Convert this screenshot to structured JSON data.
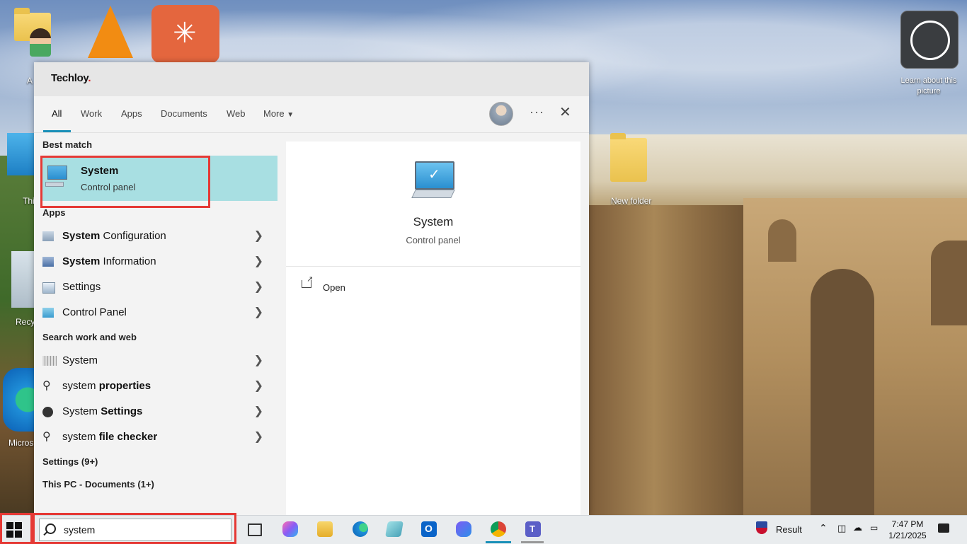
{
  "desktop": {
    "new_folder_label": "New folder",
    "learn_label": "Learn about this picture",
    "partial_labels": [
      "A",
      "Thi",
      "Recy",
      "Micros"
    ]
  },
  "panel": {
    "brand": "Techloy",
    "tabs": [
      "All",
      "Work",
      "Apps",
      "Documents",
      "Web",
      "More"
    ],
    "active_tab": "All",
    "best_match_heading": "Best match",
    "best_match": {
      "title": "System",
      "subtitle": "Control panel"
    },
    "apps_heading": "Apps",
    "apps": [
      {
        "bold": "System",
        "rest": " Configuration",
        "icon": "system-configuration-icon"
      },
      {
        "bold": "System",
        "rest": " Information",
        "icon": "system-information-icon"
      },
      {
        "bold": "",
        "rest": "Settings",
        "icon": "settings-app-icon"
      },
      {
        "bold": "",
        "rest": "Control Panel",
        "icon": "control-panel-icon"
      }
    ],
    "web_heading": "Search work and web",
    "web": [
      {
        "bold": "",
        "rest": "System",
        "icon": "web-thumbnail-icon"
      },
      {
        "bold": "",
        "rest": "system ",
        "bold2": "properties",
        "icon": "search-icon"
      },
      {
        "bold": "",
        "rest": "System ",
        "bold2": "Settings",
        "icon": "chatgpt-icon"
      },
      {
        "bold": "",
        "rest": "system ",
        "bold2": "file checker",
        "icon": "search-icon"
      }
    ],
    "settings_heading": "Settings (9+)",
    "documents_heading": "This PC - Documents (1+)",
    "detail": {
      "title": "System",
      "subtitle": "Control panel",
      "open_label": "Open"
    }
  },
  "taskbar": {
    "search_value": "system",
    "weather_label": "Result",
    "time": "7:47 PM",
    "date": "1/21/2025"
  },
  "colors": {
    "best_match_bg": "#a8dfe2",
    "highlight_border": "#e53935",
    "tab_underline": "#1a90b8"
  }
}
